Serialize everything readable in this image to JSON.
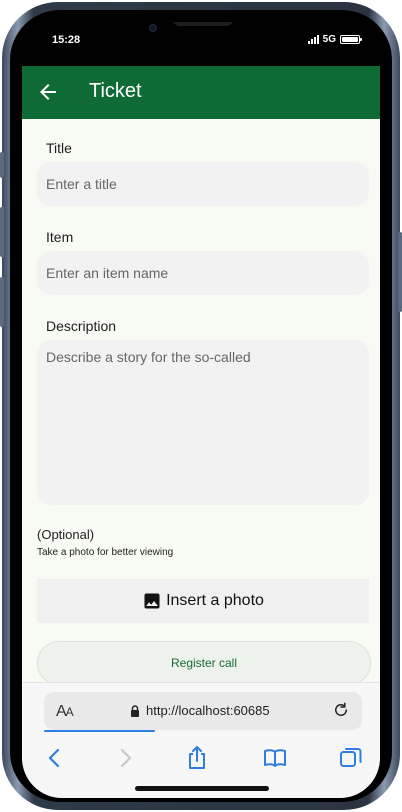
{
  "status": {
    "time": "15:28",
    "network": "5G"
  },
  "appbar": {
    "title": "Ticket"
  },
  "form": {
    "title_label": "Title",
    "title_placeholder": "Enter a title",
    "item_label": "Item",
    "item_placeholder": "Enter an item name",
    "description_label": "Description",
    "description_placeholder": "Describe a story for the so-called",
    "optional_label": "(Optional)",
    "photo_hint": "Take a photo for better viewing",
    "insert_photo_label": "Insert a photo",
    "register_label": "Register call"
  },
  "browser": {
    "aa_big": "A",
    "aa_small": "A",
    "url": "http://localhost:60685",
    "page_load_progress": 0.35
  },
  "icons": {
    "back": "arrow-left-icon",
    "photo": "image-icon",
    "lock": "lock-icon",
    "reload": "reload-icon",
    "nav_back": "chevron-left-icon",
    "nav_forward": "chevron-right-icon",
    "share": "share-icon",
    "bookmarks": "book-icon",
    "tabs": "tabs-icon"
  },
  "colors": {
    "appbar": "#0f6b35",
    "content_bg": "#f8faf4",
    "field_bg": "#f2f2f2",
    "register_text": "#1a6b33",
    "browser_accent": "#2f7de1"
  }
}
